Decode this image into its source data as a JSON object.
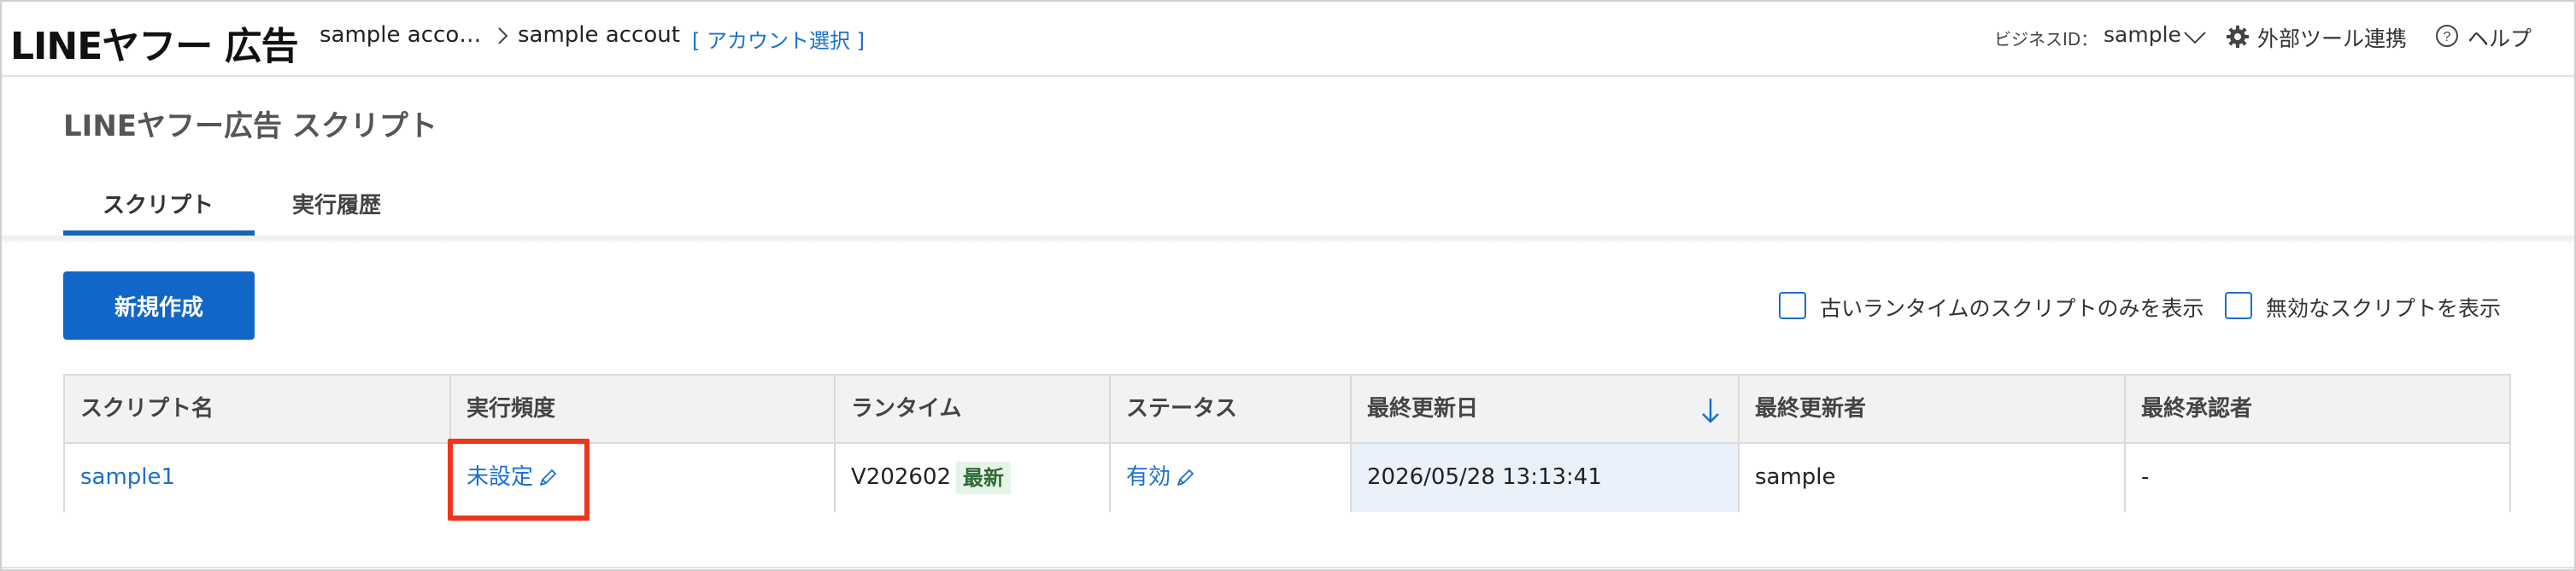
{
  "header": {
    "logo": "LINEヤフー 広告",
    "breadcrumb": {
      "account_truncated": "sample acco…",
      "current": "sample accout",
      "account_select_link": "[ アカウント選択 ]"
    },
    "business_id_label": "ビジネスID：",
    "business_id_value": "sample",
    "external_tools": "外部ツール連携",
    "help": "ヘルプ"
  },
  "page": {
    "title": "LINEヤフー広告 スクリプト",
    "tabs": [
      {
        "label": "スクリプト",
        "active": true
      },
      {
        "label": "実行履歴",
        "active": false
      }
    ]
  },
  "toolbar": {
    "new_button": "新規作成",
    "filters": [
      {
        "label": "古いランタイムのスクリプトのみを表示",
        "checked": false
      },
      {
        "label": "無効なスクリプトを表示",
        "checked": false
      }
    ]
  },
  "table": {
    "columns": [
      "スクリプト名",
      "実行頻度",
      "ランタイム",
      "ステータス",
      "最終更新日",
      "最終更新者",
      "最終承認者"
    ],
    "sorted_column": "最終更新日",
    "sort_direction": "desc",
    "rows": [
      {
        "name": "sample1",
        "frequency": "未設定",
        "runtime": "V202602",
        "runtime_badge": "最新",
        "status": "有効",
        "updated_at": "2026/05/28 13:13:41",
        "updated_by": "sample",
        "approved_by": "-"
      }
    ]
  },
  "colors": {
    "primary": "#1266c8",
    "link": "#1a6fd1",
    "highlight": "#f0351e",
    "badge_bg": "#e6f4e8"
  }
}
